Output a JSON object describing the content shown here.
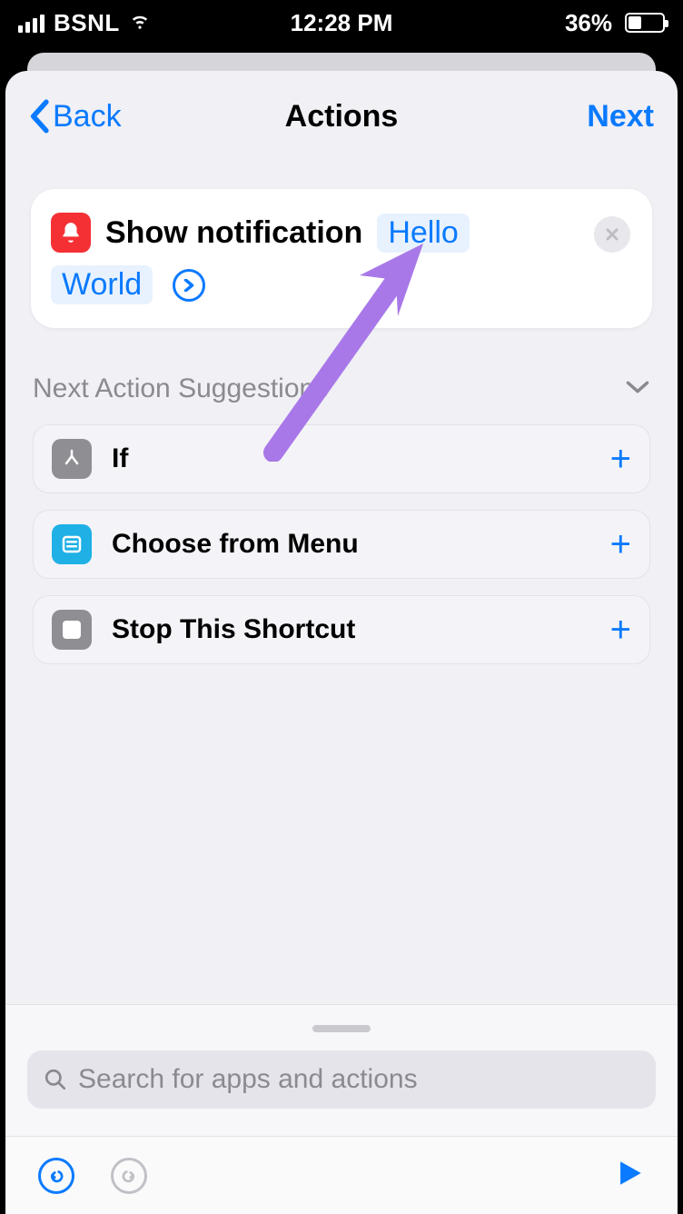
{
  "statusbar": {
    "carrier": "BSNL",
    "time": "12:28 PM",
    "battery_pct": "36%"
  },
  "nav": {
    "back_label": "Back",
    "title": "Actions",
    "next_label": "Next"
  },
  "action_card": {
    "prefix_text": "Show notification",
    "token_title": "Hello",
    "token_body": "World"
  },
  "suggestions": {
    "header": "Next Action Suggestions",
    "items": [
      {
        "icon": "if-icon",
        "label": "If"
      },
      {
        "icon": "menu-icon",
        "label": "Choose from Menu"
      },
      {
        "icon": "stop-icon",
        "label": "Stop This Shortcut"
      }
    ]
  },
  "search": {
    "placeholder": "Search for apps and actions"
  }
}
